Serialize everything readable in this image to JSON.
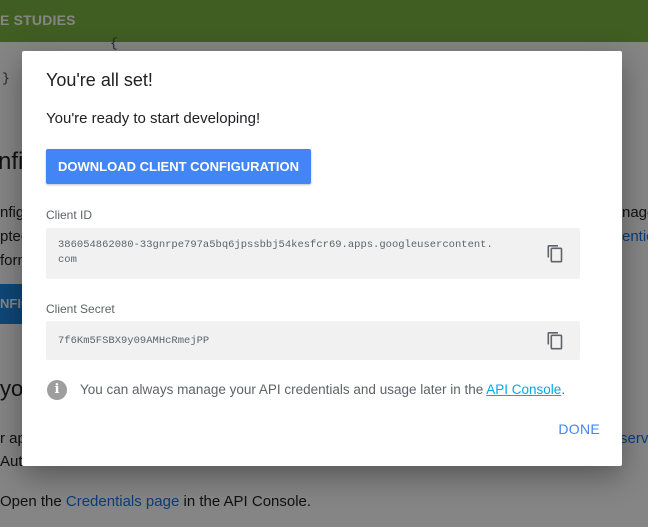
{
  "background": {
    "header_title": "E STUDIES",
    "code_brace_top": "{",
    "code_brace": "}",
    "heading_fragment": "nfig",
    "left_lines": [
      "nfig",
      "ptec",
      "form"
    ],
    "right_lines": [
      "nage",
      "entica"
    ],
    "button_fragment": "NFIG",
    "section_heading_fragment": "yo",
    "left_lines_2": [
      "r ap",
      "Aut"
    ],
    "right_line_2": "serv",
    "bottom_text_before": "Open the ",
    "bottom_link": "Credentials page",
    "bottom_text_after": " in the API Console."
  },
  "dialog": {
    "title": "You're all set!",
    "subtitle": "You're ready to start developing!",
    "download_button": "DOWNLOAD CLIENT CONFIGURATION",
    "client_id_label": "Client ID",
    "client_id_value": "386054862080-33gnrpe797a5bq6jpssbbj54kesfcr69.apps.googleusercontent.com",
    "client_secret_label": "Client Secret",
    "client_secret_value": "7f6Km5FSBX9y09AMHcRmejPP",
    "info_text": "You can always manage your API credentials and usage later in the ",
    "info_link": "API Console",
    "info_period": ".",
    "done_button": "DONE"
  },
  "icons": {
    "copy": "copy-icon",
    "info": "info-icon"
  },
  "colors": {
    "header_green": "#7cb342",
    "primary_blue": "#4285f4",
    "link_cyan": "#00a8e6"
  }
}
